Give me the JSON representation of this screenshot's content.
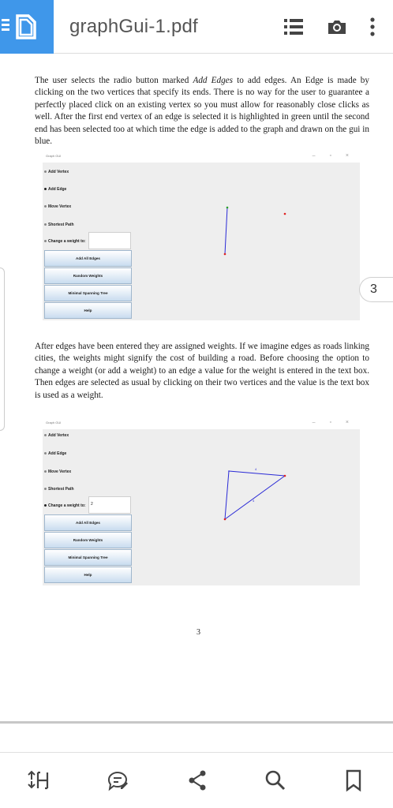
{
  "header": {
    "file_title": "graphGui-1.pdf",
    "icons": [
      "menu-file-icon",
      "list-icon",
      "camera-icon",
      "more-vertical-icon"
    ]
  },
  "doc": {
    "para1_a": "The user selects the radio button marked ",
    "para1_em": "Add Edges",
    "para1_b": " to add edges. An Edge is made by clicking on the two vertices that specify its ends. There is no way for the user to guarantee a perfectly placed click on an existing vertex so you must allow for reasonably close clicks as well. After the first end vertex of an edge is selected it is highlighted in green until the second end has been selected too at which time the edge is added to the graph and drawn on the gui in blue.",
    "para2": "After edges have been entered they are assigned weights. If we imagine edges as roads linking cities, the weights might signify the cost of building a road. Before choosing the option to change a weight (or add a weight) to an edge a value for the weight is entered in the text box. Then edges are selected as usual by clicking on their two vertices and the value is the text box is used as a weight.",
    "page_number": "3"
  },
  "gui1": {
    "window_title": "Graph GUI",
    "controls": "–  ▫  ×",
    "radios": [
      "Add Vertex",
      "Add Edge",
      "Move Vertex",
      "Shortest Path",
      "Change a weight to:"
    ],
    "selected_radio": "Add Edge",
    "weight_value": "",
    "buttons": [
      "Add All Edges",
      "Random Weights",
      "Minimal Spanning Tree",
      "Help"
    ]
  },
  "gui2": {
    "window_title": "Graph GUI",
    "controls": "–  ▫  ×",
    "radios": [
      "Add Vertex",
      "Add Edge",
      "Move Vertex",
      "Shortest Path",
      "Change a weight to:"
    ],
    "selected_radio": "Change a weight to:",
    "weight_value": "2",
    "buttons": [
      "Add All Edges",
      "Random Weights",
      "Minimal Spanning Tree",
      "Help"
    ],
    "edge_labels": [
      "4",
      "4"
    ]
  },
  "page_indicator": "3",
  "bottom_bar": {
    "icons": [
      "reflow-icon",
      "comment-icon",
      "share-icon",
      "search-icon",
      "bookmark-icon"
    ]
  },
  "colors": {
    "accent": "#3f97ea",
    "edge": "#2a2ad6",
    "vertex": "#e02020"
  }
}
